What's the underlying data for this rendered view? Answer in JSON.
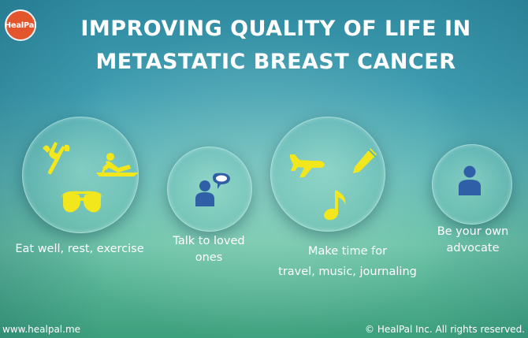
{
  "brand": {
    "logo_text": "HealPal"
  },
  "title": {
    "line1": "IMPROVING QUALITY OF LIFE IN",
    "line2": "METASTATIC BREAST CANCER"
  },
  "items": [
    {
      "label_lines": [
        "Eat well, rest, exercise"
      ],
      "icons": [
        "fork-knife-icon",
        "sunbathing-icon",
        "swim-goggles-icon"
      ]
    },
    {
      "label_lines": [
        "Talk to loved",
        "ones"
      ],
      "icons": [
        "person-speech-icon"
      ]
    },
    {
      "label_lines": [
        "Make time for",
        "travel, music, journaling"
      ],
      "icons": [
        "airplane-icon",
        "pencil-icon",
        "music-note-icon"
      ]
    },
    {
      "label_lines": [
        "Be your own",
        "advocate"
      ],
      "icons": [
        "person-icon"
      ]
    }
  ],
  "footer": {
    "website": "www.healpal.me",
    "copyright": "© HealPal Inc. All rights reserved."
  },
  "colors": {
    "icon_yellow": "#f2e61c",
    "icon_blue": "#2f5fa6",
    "logo_orange": "#e2552d"
  }
}
